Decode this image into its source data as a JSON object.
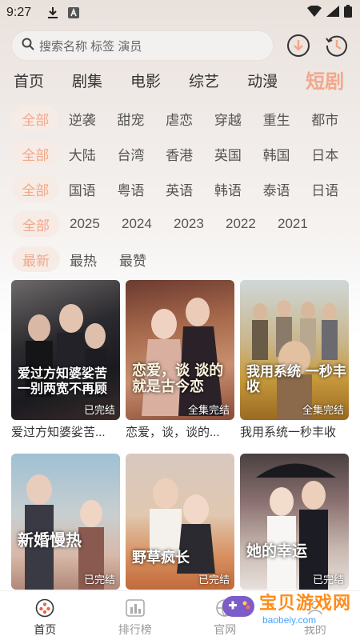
{
  "status_bar": {
    "time": "9:27"
  },
  "search": {
    "placeholder": "搜索名称 标签 演员"
  },
  "tabs": [
    {
      "label": "首页"
    },
    {
      "label": "剧集"
    },
    {
      "label": "电影"
    },
    {
      "label": "综艺"
    },
    {
      "label": "动漫"
    },
    {
      "label": "短剧"
    }
  ],
  "filters": {
    "genre": [
      "全部",
      "逆袭",
      "甜宠",
      "虐恋",
      "穿越",
      "重生",
      "都市"
    ],
    "region": [
      "全部",
      "大陆",
      "台湾",
      "香港",
      "英国",
      "韩国",
      "日本"
    ],
    "language": [
      "全部",
      "国语",
      "粤语",
      "英语",
      "韩语",
      "泰语",
      "日语"
    ],
    "year": [
      "全部",
      "2025",
      "2024",
      "2023",
      "2022",
      "2021"
    ],
    "sort": [
      "最新",
      "最热",
      "最赞"
    ]
  },
  "cards": [
    {
      "title": "爱过方知婆娑苦...",
      "art": "爱过方知婆娑苦 一别两宽不再顾",
      "badge": "已完结"
    },
    {
      "title": "恋爱，谈，谈的...",
      "art": "恋爱，谈 谈的就是古今恋",
      "badge": "全集完结"
    },
    {
      "title": "我用系统一秒丰收",
      "art": "我用系统 一秒丰收",
      "badge": "全集完结"
    },
    {
      "title": "",
      "art": "新婚慢热",
      "badge": "已完结"
    },
    {
      "title": "",
      "art": "野草疯长",
      "badge": "已完结"
    },
    {
      "title": "",
      "art": "她的幸运",
      "badge": "已完结"
    }
  ],
  "bottom_nav": [
    {
      "label": "首页"
    },
    {
      "label": "排行榜"
    },
    {
      "label": "官网"
    },
    {
      "label": "我的"
    }
  ],
  "watermark": {
    "title": "宝贝游戏网",
    "url": "baobeiy.com"
  },
  "colors": {
    "accent": "#f2a88a",
    "chip_bg": "#f7ebe5"
  }
}
